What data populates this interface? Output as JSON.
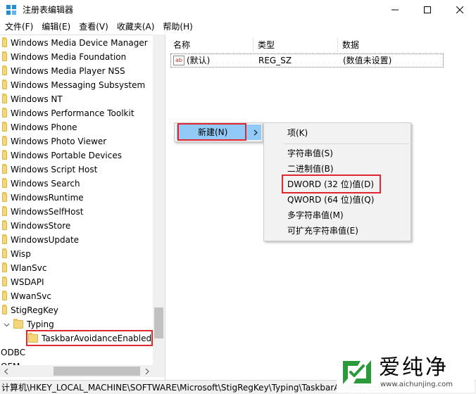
{
  "window": {
    "title": "注册表编辑器"
  },
  "menu": [
    "文件(F)",
    "编辑(E)",
    "查看(V)",
    "收藏夹(A)",
    "帮助(H)"
  ],
  "tree": {
    "items": [
      "Windows Media Device Manager",
      "Windows Media Foundation",
      "Windows Media Player NSS",
      "Windows Messaging Subsystem",
      "Windows NT",
      "Windows Performance Toolkit",
      "Windows Phone",
      "Windows Photo Viewer",
      "Windows Portable Devices",
      "Windows Script Host",
      "Windows Search",
      "WindowsRuntime",
      "WindowsSelfHost",
      "WindowsStore",
      "WindowsUpdate",
      "Wisp",
      "WlanSvc",
      "WSDAPI",
      "WwanSvc",
      "StigRegKey",
      "Typing",
      "TaskbarAvoidanceEnabled",
      "ODBC",
      "OEM"
    ]
  },
  "list": {
    "columns": [
      "名称",
      "类型",
      "数据"
    ],
    "rows": [
      {
        "name": "(默认)",
        "type": "REG_SZ",
        "data": "(数值未设置)",
        "icon": "ab"
      }
    ]
  },
  "context_menu": {
    "new_label": "新建(N)",
    "submenu": {
      "key": "项(K)",
      "string": "字符串值(S)",
      "binary": "二进制值(B)",
      "dword": "DWORD (32 位)值(D)",
      "qword": "QWORD (64 位)值(Q)",
      "multi_string": "多字符串值(M)",
      "expand_string": "可扩充字符串值(E)"
    }
  },
  "status": {
    "path": "计算机\\HKEY_LOCAL_MACHINE\\SOFTWARE\\Microsoft\\StigRegKey\\Typing\\TaskbarAvoidanceEnabled"
  },
  "watermark": {
    "brand": "爱纯净",
    "url": "www.aichunjing.com"
  },
  "colors": {
    "highlight": "#91c9f7",
    "annotation_red": "#e0262f",
    "folder": "#f5d77b",
    "titlebar_icon": "#1e8fd6",
    "watermark_green": "#2a9a3a"
  }
}
